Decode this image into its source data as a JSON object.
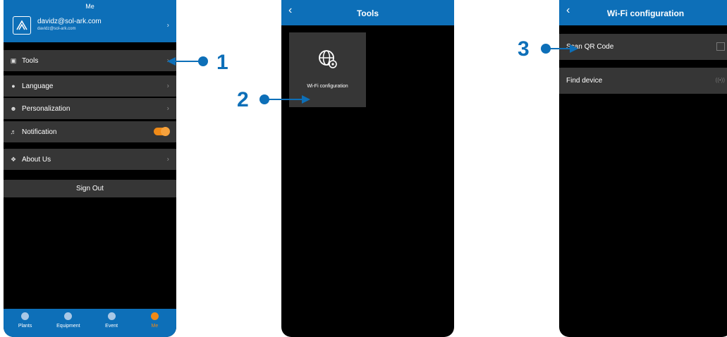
{
  "screen1": {
    "header_title": "Me",
    "profile": {
      "email": "davidz@sol-ark.com",
      "sub": "davidz@sol-ark.com"
    },
    "items": {
      "tools": "Tools",
      "language": "Language",
      "personalization": "Personalization",
      "notification": "Notification",
      "about": "About Us"
    },
    "sign_out": "Sign Out",
    "tabs": {
      "plants": "Plants",
      "equipment": "Equipment",
      "event": "Event",
      "me": "Me"
    }
  },
  "screen2": {
    "title": "Tools",
    "tile_label": "Wi-Fi configuration"
  },
  "screen3": {
    "title": "Wi-Fi configuration",
    "scan": "Scan QR Code",
    "find": "Find device"
  },
  "callouts": {
    "one": "1",
    "two": "2",
    "three": "3"
  },
  "colors": {
    "brand_blue": "#0d6fb8",
    "toggle_orange": "#f08a17",
    "row_gray": "#363636"
  }
}
